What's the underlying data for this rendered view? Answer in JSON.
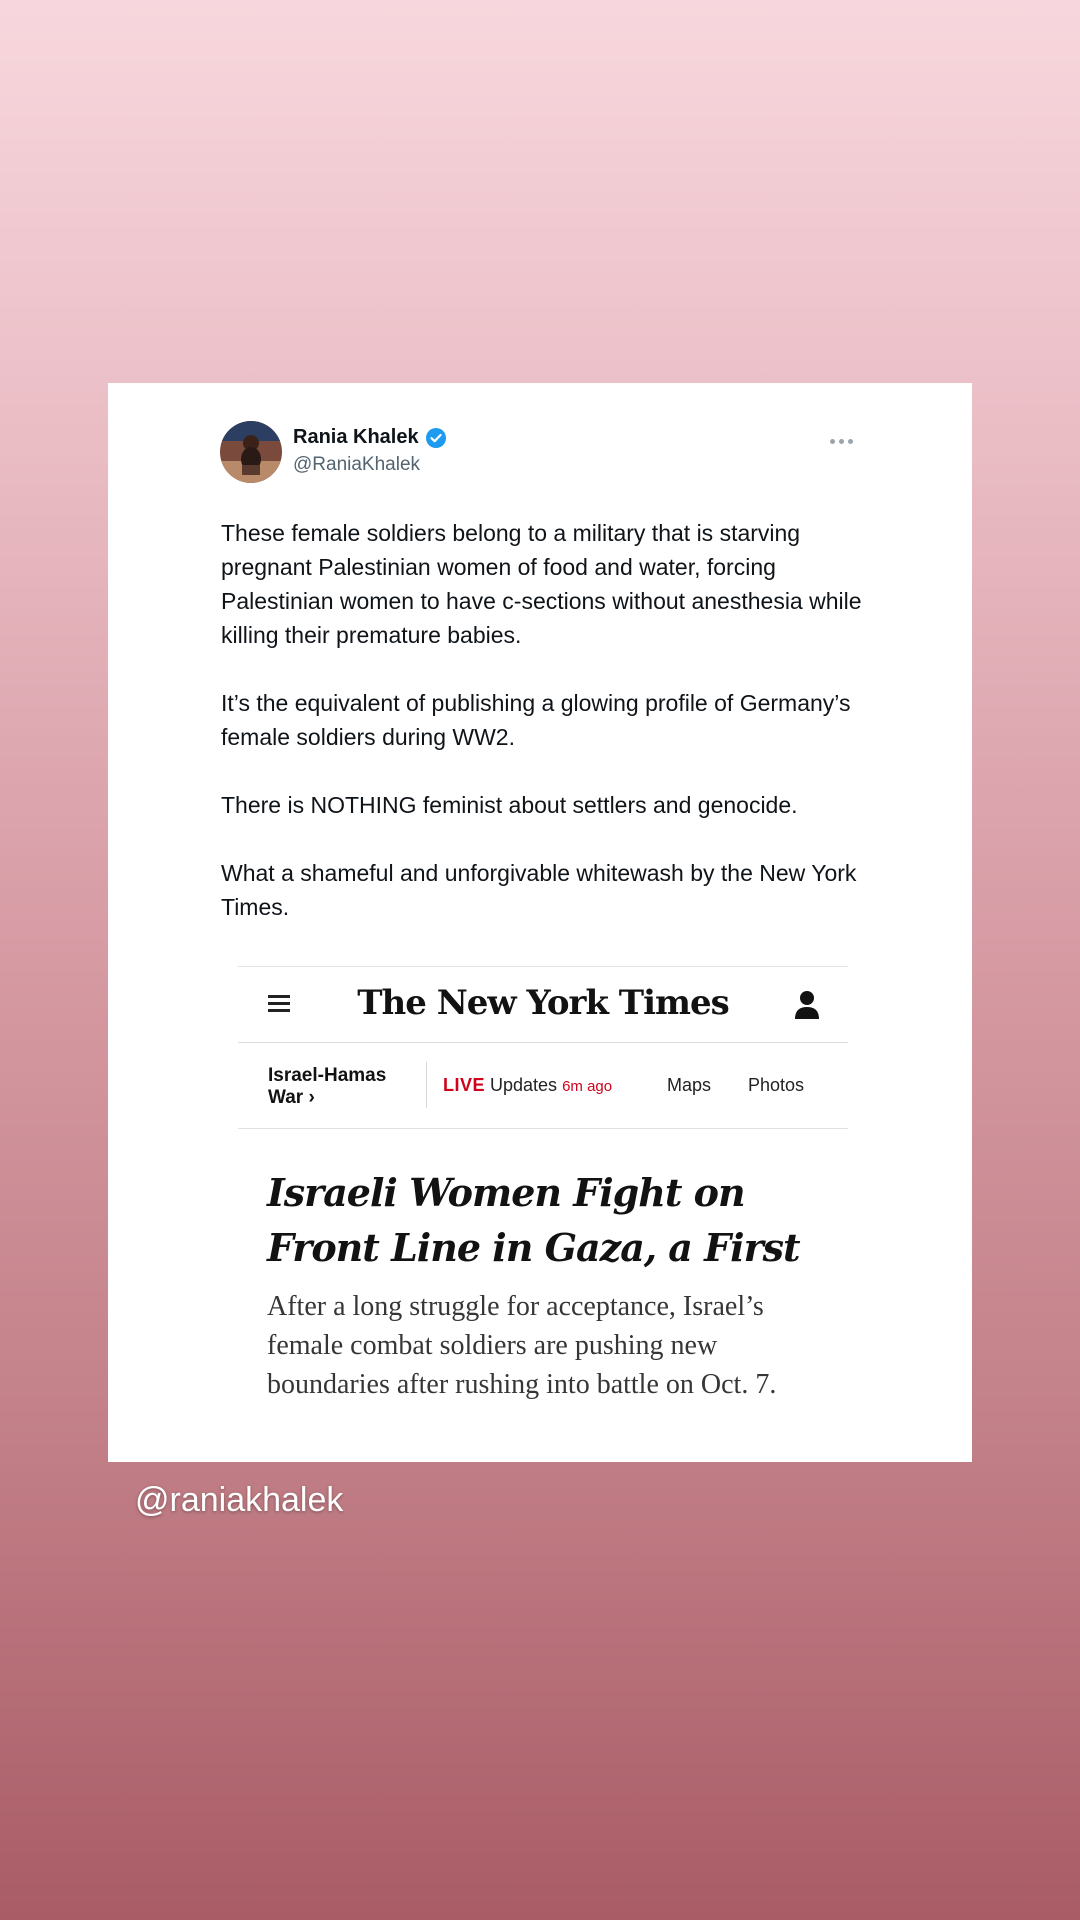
{
  "tweet": {
    "author_name": "Rania Khalek",
    "author_handle": "@RaniaKhalek",
    "verified": true,
    "paragraphs": [
      "These female soldiers belong to a military that is starving pregnant Palestinian women of food and water, forcing Palestinian women to have c-sections without anesthesia while killing their premature babies.",
      "It’s the equivalent of publishing a glowing profile of Germany’s female soldiers during WW2.",
      "There is NOTHING feminist about settlers and genocide.",
      "What a shameful and unforgivable whitewash by the New York Times."
    ]
  },
  "nyt": {
    "logo": "The New York Times",
    "nav": {
      "section": "Israel-Hamas War ›",
      "live": "LIVE",
      "updates": "Updates",
      "time_ago": "6m ago",
      "maps": "Maps",
      "photos": "Photos"
    },
    "headline": "Israeli Women Fight on Front Line in Gaza, a First",
    "summary": "After a long struggle for acceptance, Israel’s female combat soldiers are pushing new boundaries after rushing into battle on Oct. 7."
  },
  "story_caption": "@raniakhalek",
  "colors": {
    "verified_blue": "#1d9bf0",
    "live_red": "#d0021b"
  }
}
